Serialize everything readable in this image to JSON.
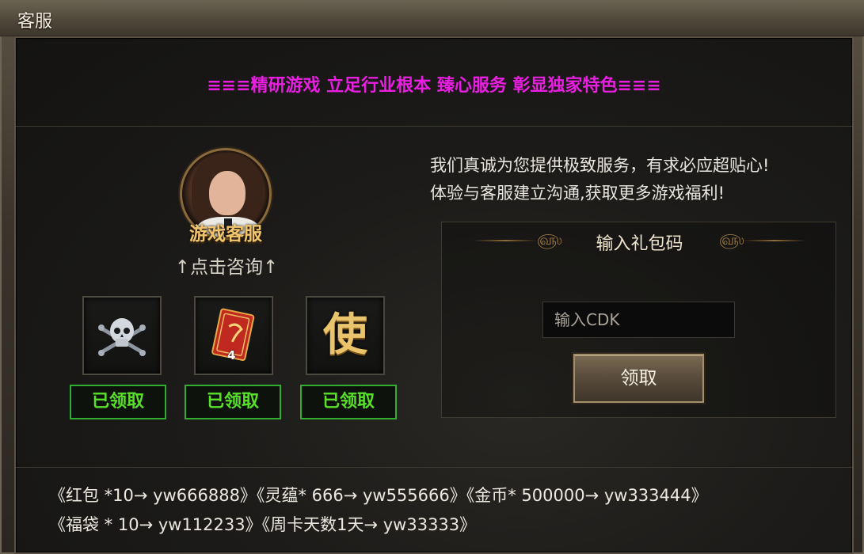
{
  "window": {
    "title": "客服"
  },
  "slogan": "≡≡≡精研游戏 立足行业根本 臻心服务 彰显独家特色≡≡≡",
  "service": {
    "caption": "游戏客服",
    "consult_text": "↑点击咨询↑"
  },
  "rewards": [
    {
      "icon": "skull-crossbones-icon",
      "badge": "",
      "status": "已领取"
    },
    {
      "icon": "red-card-icon",
      "badge": "4",
      "status": "已领取"
    },
    {
      "icon": "shi-character-icon",
      "glyph": "使",
      "badge": "",
      "status": "已领取"
    }
  ],
  "description": [
    "我们真诚为您提供极致服务，有求必应超贴心!",
    "体验与客服建立沟通,获取更多游戏福利!"
  ],
  "cdk": {
    "title": "输入礼包码",
    "placeholder": "输入CDK",
    "button_label": "领取"
  },
  "codes": [
    "《红包 *10→ yw666888》《灵蕴* 666→ yw555666》《金币* 500000→ yw333444》",
    "《福袋 * 10→ yw112233》《周卡天数1天→ yw33333》"
  ],
  "colors": {
    "slogan": "#e81fe0",
    "claimed": "#58e02b",
    "caption_gold": "#f1c56e"
  }
}
